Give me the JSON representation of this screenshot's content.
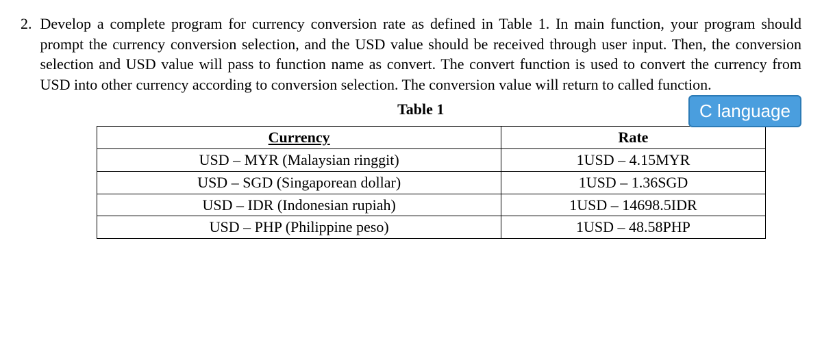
{
  "question": {
    "number": "2.",
    "text": "Develop a complete program for currency conversion rate as defined in Table 1. In main function, your program should prompt the currency conversion selection, and the USD value should be received through user input. Then, the conversion selection and USD value will pass to function name as convert. The convert function is used to convert the currency from USD into other currency according to conversion selection. The conversion value will return to called function."
  },
  "table": {
    "caption": "Table 1",
    "badge": "C language",
    "headers": {
      "currency": "Currency",
      "rate": "Rate"
    },
    "rows": [
      {
        "currency": "USD – MYR (Malaysian ringgit)",
        "rate": "1USD – 4.15MYR"
      },
      {
        "currency": "USD – SGD (Singaporean dollar)",
        "rate": "1USD – 1.36SGD"
      },
      {
        "currency": "USD – IDR (Indonesian rupiah)",
        "rate": "1USD – 14698.5IDR"
      },
      {
        "currency": "USD – PHP (Philippine peso)",
        "rate": "1USD – 48.58PHP"
      }
    ]
  }
}
